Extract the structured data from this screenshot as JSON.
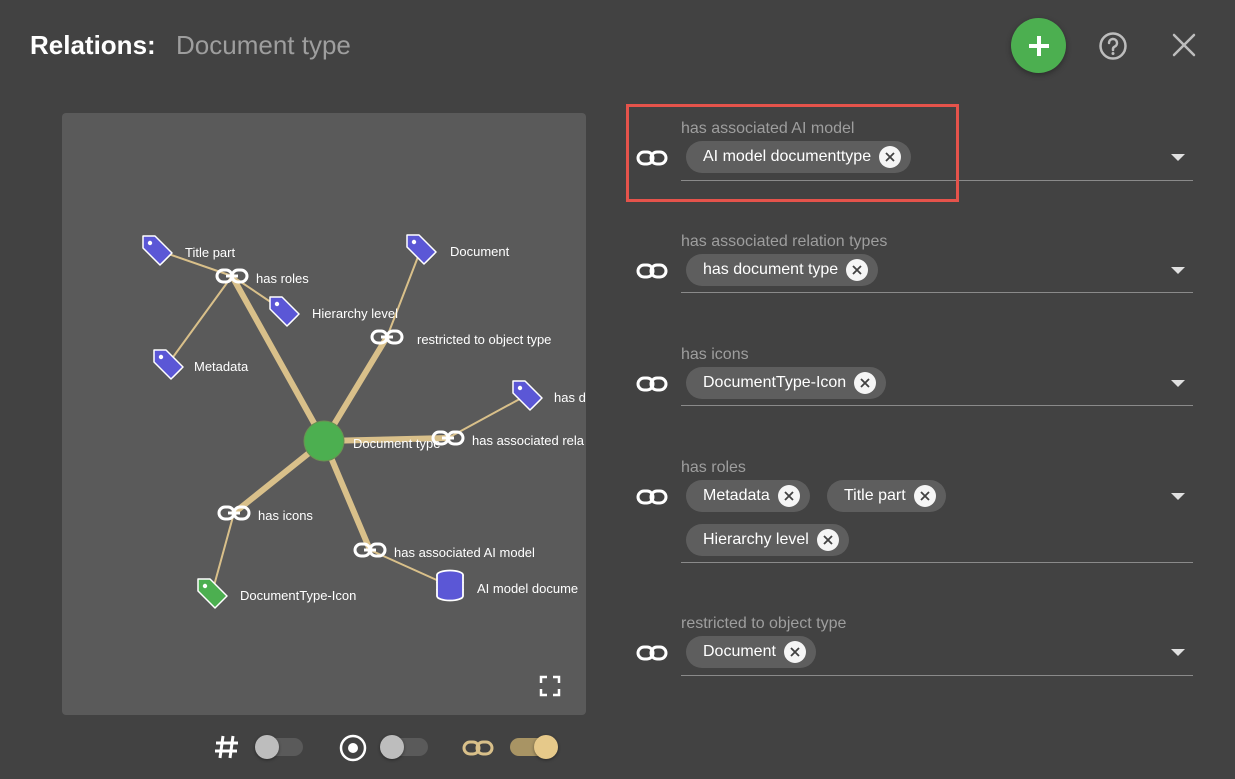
{
  "header": {
    "title": "Relations:",
    "subtitle": "Document type"
  },
  "colors": {
    "background": "#424242",
    "accent_green": "#4caf50",
    "tag_purple": "#5b57d6",
    "edge_tan": "#d9c08a",
    "highlight_red": "#e5534b"
  },
  "graph": {
    "center_label": "Document type",
    "nodes": {
      "title_part": "Title part",
      "has_roles": "has roles",
      "hierarchy_level": "Hierarchy level",
      "metadata": "Metadata",
      "document": "Document",
      "restricted_to_object_type": "restricted to object type",
      "has_d": "has d",
      "has_associated_rela": "has associated rela",
      "has_icons": "has icons",
      "has_associated_ai_model": "has associated AI model",
      "documenttype_icon": "DocumentType-Icon",
      "ai_model_docume": "AI model docume"
    }
  },
  "toggles": [
    {
      "icon": "hash-icon",
      "on": false
    },
    {
      "icon": "target-icon",
      "on": false
    },
    {
      "icon": "link-icon",
      "on": true
    }
  ],
  "relations": [
    {
      "label": "has associated AI model",
      "chips": [
        "AI model documenttype"
      ]
    },
    {
      "label": "has associated relation types",
      "chips": [
        "has document type"
      ]
    },
    {
      "label": "has icons",
      "chips": [
        "DocumentType-Icon"
      ]
    },
    {
      "label": "has roles",
      "chips": [
        "Metadata",
        "Title part",
        "Hierarchy level"
      ]
    },
    {
      "label": "restricted to object type",
      "chips": [
        "Document"
      ]
    }
  ]
}
